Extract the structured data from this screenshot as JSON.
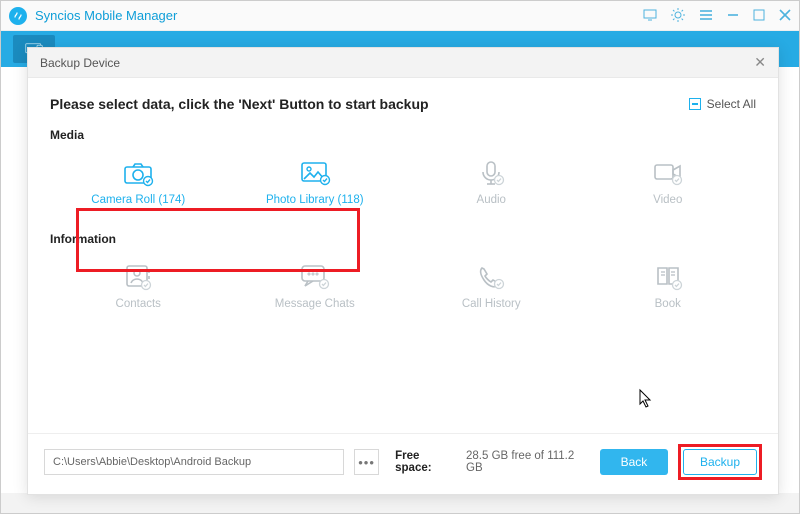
{
  "titlebar": {
    "appName": "Syncios Mobile Manager"
  },
  "modal": {
    "title": "Backup Device",
    "instruction": "Please select data, click the 'Next' Button to start backup",
    "selectAll": "Select All",
    "sections": {
      "media": {
        "label": "Media",
        "cameraRoll": "Camera Roll (174)",
        "photoLibrary": "Photo Library (118)",
        "audio": "Audio",
        "video": "Video"
      },
      "info": {
        "label": "Information",
        "contacts": "Contacts",
        "messageChats": "Message Chats",
        "callHistory": "Call History",
        "book": "Book"
      }
    },
    "footer": {
      "path": "C:\\Users\\Abbie\\Desktop\\Android Backup",
      "freeLabel": "Free space:",
      "freeValue": "28.5 GB free of 111.2 GB",
      "back": "Back",
      "backup": "Backup"
    }
  }
}
